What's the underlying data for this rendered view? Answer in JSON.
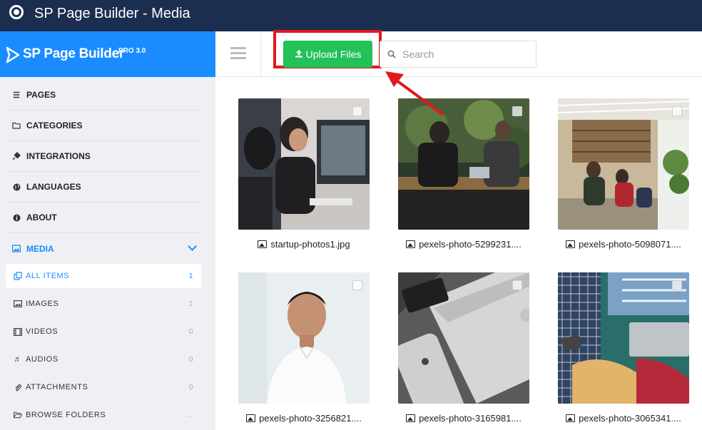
{
  "window": {
    "title": "SP Page Builder - Media"
  },
  "brand": {
    "name": "SP Page Builder",
    "version": "PRO 3.0"
  },
  "nav": [
    {
      "label": "PAGES",
      "icon": "list-icon"
    },
    {
      "label": "CATEGORIES",
      "icon": "folder-icon"
    },
    {
      "label": "INTEGRATIONS",
      "icon": "plug-icon"
    },
    {
      "label": "LANGUAGES",
      "icon": "globe-icon"
    },
    {
      "label": "ABOUT",
      "icon": "info-icon"
    },
    {
      "label": "MEDIA",
      "icon": "image-icon",
      "active": true
    }
  ],
  "media_sub": [
    {
      "label": "ALL ITEMS",
      "count": "1",
      "icon": "copy-icon",
      "selected": true
    },
    {
      "label": "IMAGES",
      "count": "1",
      "icon": "image-icon"
    },
    {
      "label": "VIDEOS",
      "count": "0",
      "icon": "film-icon"
    },
    {
      "label": "AUDIOS",
      "count": "0",
      "icon": "music-icon"
    },
    {
      "label": "ATTACHMENTS",
      "count": "0",
      "icon": "paperclip-icon"
    },
    {
      "label": "BROWSE FOLDERS",
      "count": "...",
      "icon": "folder-open-icon"
    }
  ],
  "toolbar": {
    "upload_label": "Upload Files",
    "search_placeholder": "Search"
  },
  "media_items": [
    {
      "name": "startup-photos1.jpg"
    },
    {
      "name": "pexels-photo-5299231...."
    },
    {
      "name": "pexels-photo-5098071...."
    },
    {
      "name": "pexels-photo-3256821...."
    },
    {
      "name": "pexels-photo-3165981...."
    },
    {
      "name": "pexels-photo-3065341...."
    }
  ],
  "colors": {
    "titlebar": "#1c2e4f",
    "brand": "#1a8cff",
    "upload_button": "#23c159",
    "highlight": "#e0191c"
  }
}
